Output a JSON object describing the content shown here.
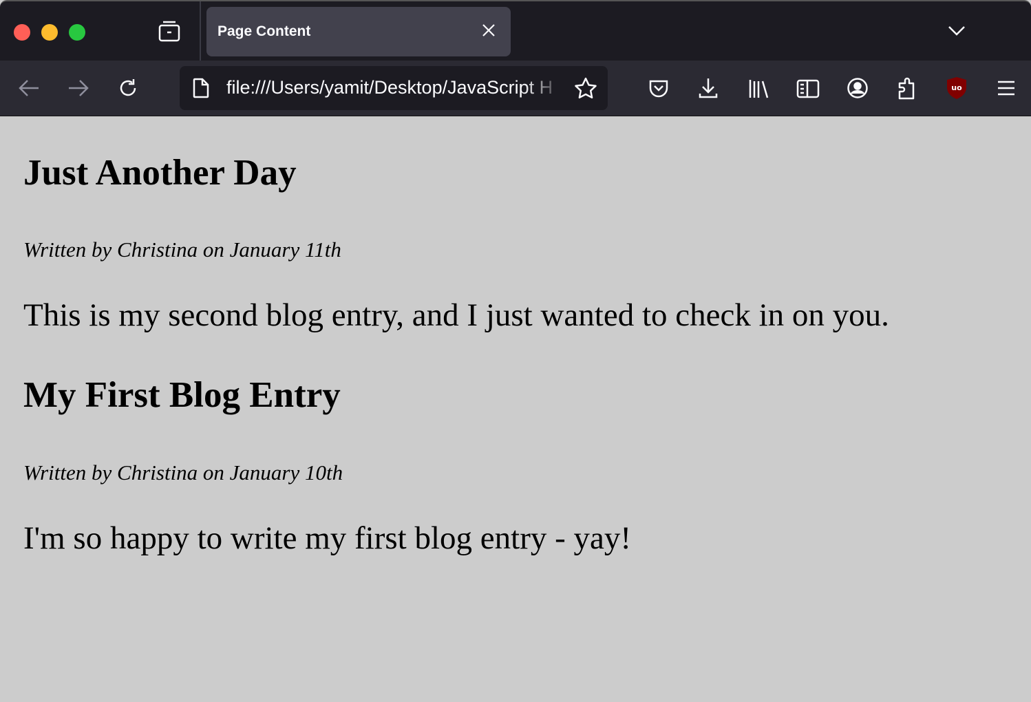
{
  "browser": {
    "tab_title": "Page Content",
    "url": "file:///Users/yamit/Desktop/JavaScript H",
    "colors": {
      "close": "#ff5f57",
      "minimize": "#febc2e",
      "maximize": "#28c840",
      "ublock": "#800000"
    }
  },
  "posts": [
    {
      "title": "Just Another Day",
      "byline": "Written by Christina on January 11th",
      "body": "This is my second blog entry, and I just wanted to check in on you."
    },
    {
      "title": "My First Blog Entry",
      "byline": "Written by Christina on January 10th",
      "body": "I'm so happy to write my first blog entry - yay!"
    }
  ]
}
